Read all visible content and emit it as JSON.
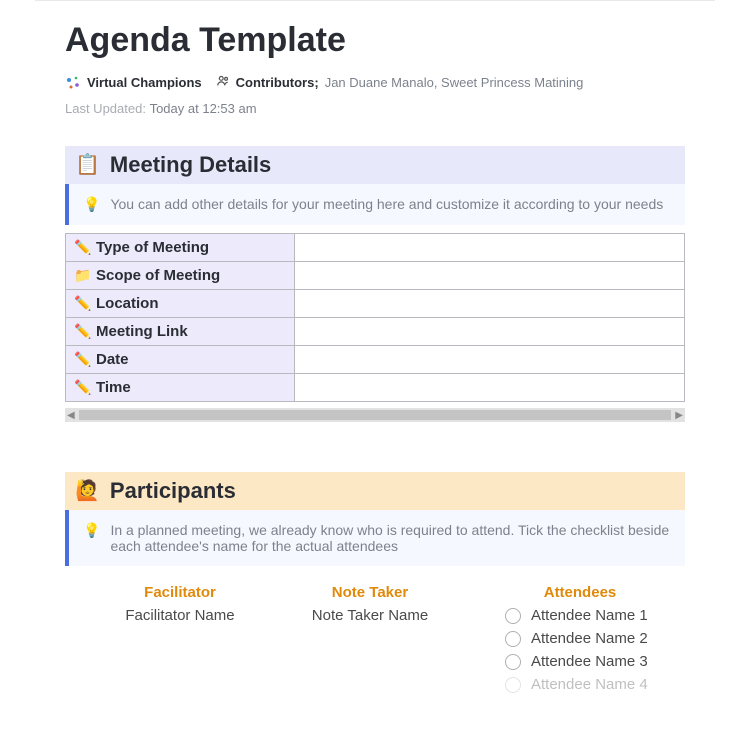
{
  "title": "Agenda Template",
  "meta": {
    "workspace": "Virtual Champions",
    "contributors_label": "Contributors",
    "contributors": "Jan Duane Manalo, Sweet Princess Matining",
    "updated_label": "Last Updated:",
    "updated_value": "Today at 12:53 am"
  },
  "sections": {
    "details": {
      "icon": "📋",
      "title": "Meeting Details",
      "callout": "You can add other details for your meeting here and customize it according to your needs",
      "rows": [
        {
          "icon": "pencil",
          "label": "Type of Meeting",
          "value": ""
        },
        {
          "icon": "folder",
          "label": "Scope of Meeting",
          "value": ""
        },
        {
          "icon": "pencil",
          "label": "Location",
          "value": ""
        },
        {
          "icon": "pencil",
          "label": "Meeting Link",
          "value": ""
        },
        {
          "icon": "pencil",
          "label": "Date",
          "value": ""
        },
        {
          "icon": "pencil",
          "label": "Time",
          "value": ""
        }
      ]
    },
    "participants": {
      "icon": "🙋",
      "title": "Participants",
      "callout": "In a planned meeting, we already know who is required to attend. Tick the checklist beside each attendee's name for the actual attendees",
      "columns": {
        "facilitator": {
          "heading": "Facilitator",
          "value": "Facilitator Name"
        },
        "notetaker": {
          "heading": "Note Taker",
          "value": "Note Taker Name"
        },
        "attendees": {
          "heading": "Attendees",
          "items": [
            "Attendee Name 1",
            "Attendee Name 2",
            "Attendee Name 3",
            "Attendee Name 4"
          ]
        }
      }
    }
  }
}
